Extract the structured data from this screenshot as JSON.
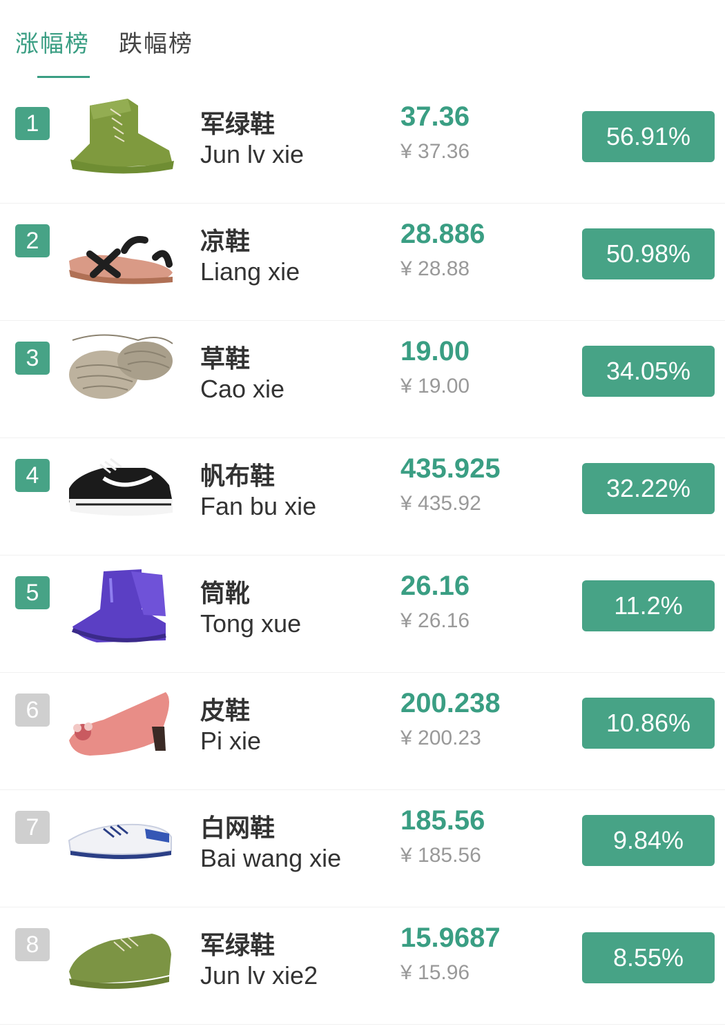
{
  "tabs": [
    {
      "label": "涨幅榜",
      "active": true
    },
    {
      "label": "跌幅榜",
      "active": false
    }
  ],
  "accent_color": "#3a9e83",
  "items": [
    {
      "rank": "1",
      "name_cn": "军绿鞋",
      "name_en": "Jun lv xie",
      "price": "37.36",
      "price_cny": "¥ 37.36",
      "change": "56.91%",
      "icon": "green-canvas-high-top-shoe-icon"
    },
    {
      "rank": "2",
      "name_cn": "凉鞋",
      "name_en": "Liang xie",
      "price": "28.886",
      "price_cny": "¥ 28.88",
      "change": "50.98%",
      "icon": "sandal-icon"
    },
    {
      "rank": "3",
      "name_cn": "草鞋",
      "name_en": "Cao xie",
      "price": "19.00",
      "price_cny": "¥ 19.00",
      "change": "34.05%",
      "icon": "straw-sandal-icon"
    },
    {
      "rank": "4",
      "name_cn": "帆布鞋",
      "name_en": "Fan bu xie",
      "price": "435.925",
      "price_cny": "¥ 435.92",
      "change": "32.22%",
      "icon": "canvas-sneaker-icon"
    },
    {
      "rank": "5",
      "name_cn": "筒靴",
      "name_en": "Tong xue",
      "price": "26.16",
      "price_cny": "¥ 26.16",
      "change": "11.2%",
      "icon": "rain-boot-icon"
    },
    {
      "rank": "6",
      "name_cn": "皮鞋",
      "name_en": "Pi xie",
      "price": "200.238",
      "price_cny": "¥ 200.23",
      "change": "10.86%",
      "icon": "pink-flat-shoe-icon"
    },
    {
      "rank": "7",
      "name_cn": "白网鞋",
      "name_en": "Bai wang xie",
      "price": "185.56",
      "price_cny": "¥ 185.56",
      "change": "9.84%",
      "icon": "white-mesh-shoe-icon"
    },
    {
      "rank": "8",
      "name_cn": "军绿鞋",
      "name_en": "Jun lv xie2",
      "price": "15.9687",
      "price_cny": "¥ 15.96",
      "change": "8.55%",
      "icon": "green-canvas-low-shoe-icon"
    }
  ]
}
